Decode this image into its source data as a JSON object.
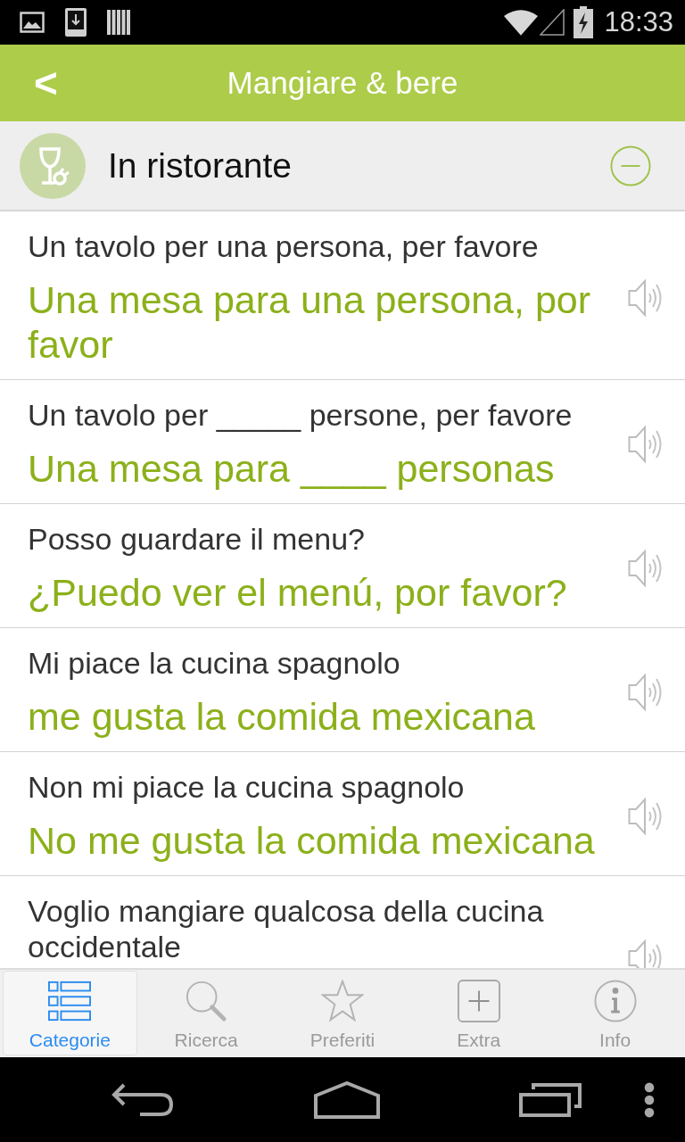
{
  "status_bar": {
    "time": "18:33"
  },
  "app_bar": {
    "back_label": "<",
    "title": "Mangiare & bere"
  },
  "section": {
    "title": "In ristorante",
    "expanded": true
  },
  "phrases": [
    {
      "source": "Un tavolo per una persona, per favore",
      "translation": "Una mesa para una persona, por favor"
    },
    {
      "source": "Un tavolo per _____ persone, per favore",
      "translation": "Una mesa para ____ personas"
    },
    {
      "source": "Posso guardare il menu?",
      "translation": "¿Puedo ver el menú, por favor?"
    },
    {
      "source": "Mi piace la cucina spagnolo",
      "translation": "me gusta la comida mexicana"
    },
    {
      "source": "Non mi piace la cucina spagnolo",
      "translation": "No me gusta la comida mexicana"
    },
    {
      "source": "Voglio mangiare qualcosa della cucina occidentale"
    }
  ],
  "tab_bar": {
    "tabs": [
      {
        "label": "Categorie",
        "selected": true
      },
      {
        "label": "Ricerca",
        "selected": false
      },
      {
        "label": "Preferiti",
        "selected": false
      },
      {
        "label": "Extra",
        "selected": false
      },
      {
        "label": "Info",
        "selected": false
      }
    ]
  }
}
